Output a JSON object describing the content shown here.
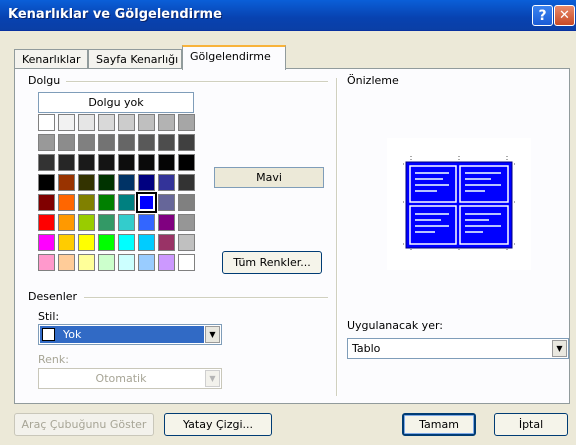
{
  "window": {
    "title": "Kenarlıklar ve Gölgelendirme",
    "help_glyph": "?",
    "close_glyph": "✕"
  },
  "tabs": [
    {
      "label": "Kenarlıklar",
      "active": false
    },
    {
      "label": "Sayfa Kenarlığı",
      "active": false
    },
    {
      "label": "Gölgelendirme",
      "active": true
    }
  ],
  "fill": {
    "group_label": "Dolgu",
    "no_fill_label": "Dolgu yok",
    "selected_color_name": "Mavi",
    "more_colors_button": "Tüm Renkler...",
    "palette": [
      [
        "#ffffff",
        "#f2f2f2",
        "#e6e6e6",
        "#d9d9d9",
        "#cccccc",
        "#bfbfbf",
        "#b3b3b3",
        "#a6a6a6"
      ],
      [
        "#999999",
        "#8c8c8c",
        "#808080",
        "#737373",
        "#666666",
        "#595959",
        "#4d4d4d",
        "#404040"
      ],
      [
        "#333333",
        "#262626",
        "#1a1a1a",
        "#141414",
        "#0d0d0d",
        "#0a0a0a",
        "#050505",
        "#000000"
      ],
      [
        "#000000",
        "#993300",
        "#333300",
        "#003300",
        "#003366",
        "#000080",
        "#333399",
        "#333333"
      ],
      [
        "#800000",
        "#ff6600",
        "#808000",
        "#008000",
        "#008080",
        "#0000ff",
        "#666699",
        "#808080"
      ],
      [
        "#ff0000",
        "#ff9900",
        "#99cc00",
        "#339966",
        "#33cccc",
        "#3366ff",
        "#800080",
        "#969696"
      ],
      [
        "#ff00ff",
        "#ffcc00",
        "#ffff00",
        "#00ff00",
        "#00ffff",
        "#00ccff",
        "#993366",
        "#c0c0c0"
      ],
      [
        "#ff99cc",
        "#ffcc99",
        "#ffff99",
        "#ccffcc",
        "#ccffff",
        "#99ccff",
        "#cc99ff",
        "#ffffff"
      ]
    ],
    "selected_swatch": [
      4,
      5
    ]
  },
  "patterns": {
    "group_label": "Desenler",
    "style_label": "Stil:",
    "style_value": "Yok",
    "color_label": "Renk:",
    "color_value": "Otomatik"
  },
  "preview": {
    "group_label": "Önizleme",
    "apply_to_label": "Uygulanacak yer:",
    "apply_to_value": "Tablo"
  },
  "footer": {
    "show_toolbar_button": "Araç Çubuğunu Göster",
    "horizontal_line_button": "Yatay Çizgi...",
    "ok_button": "Tamam",
    "cancel_button": "İptal"
  },
  "colors": {
    "title_bar": "#0a5fd8",
    "selection_highlight": "#316ac5",
    "preview_table": "#0000ff"
  }
}
